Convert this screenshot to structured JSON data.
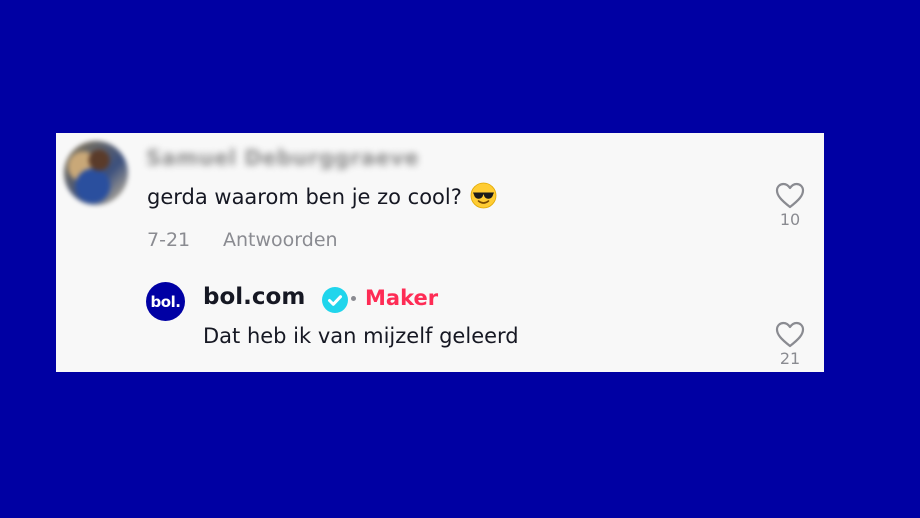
{
  "comment": {
    "username": "Samuel Deburggraeve",
    "text": "gerda waarom ben je zo cool?",
    "emoji": "smiling-face-with-sunglasses",
    "date": "7-21",
    "reply_label": "Antwoorden",
    "like_count": "10"
  },
  "reply": {
    "avatar_text": "bol",
    "username": "bol.com",
    "verified": true,
    "badge": "Maker",
    "text": "Dat heb ik van mijzelf geleerd",
    "like_count": "21"
  },
  "colors": {
    "background": "#0000a3",
    "panel": "#f8f8f8",
    "verified": "#20d5ec",
    "badge": "#fe2c55",
    "brand": "#0000a4"
  }
}
